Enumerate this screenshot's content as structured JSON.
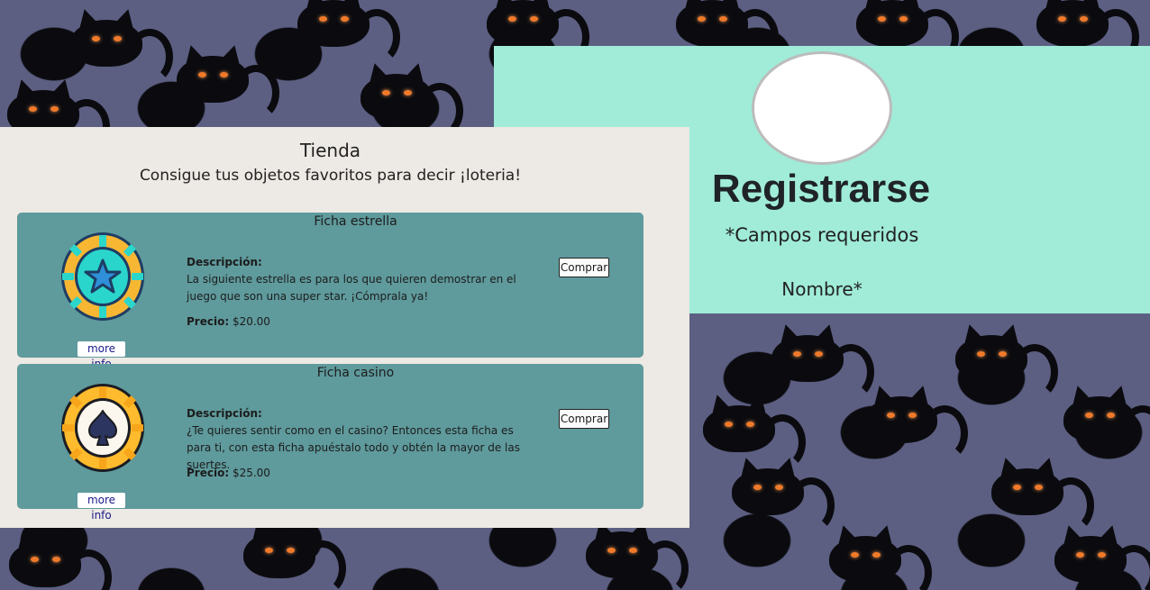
{
  "store": {
    "title": "Tienda",
    "subtitle": "Consigue tus objetos favoritos para decir ¡loteria!",
    "items": [
      {
        "name": "Ficha estrella",
        "icon": "star-chip-icon",
        "description_label": "Descripción:",
        "description": "La siguiente estrella es para los que quieren demostrar en el juego que son una super star. ¡Cómprala ya!",
        "price_label": "Precio:",
        "price": "$20.00",
        "buy_label": "Comprar",
        "more_info_label": "more info"
      },
      {
        "name": "Ficha casino",
        "icon": "spade-chip-icon",
        "description_label": "Descripción:",
        "description": "¿Te quieres sentir como en el casino? Entonces esta ficha es para ti, con esta ficha apuéstalo todo y obtén la mayor de las suertes.",
        "price_label": "Precio:",
        "price": "$25.00",
        "buy_label": "Comprar",
        "more_info_label": "more info"
      }
    ]
  },
  "register": {
    "title": "Registrarse",
    "required_note": "*Campos requeridos",
    "name_label": "Nombre*"
  },
  "colors": {
    "background": "#5c5f82",
    "register_panel": "#a0ecd8",
    "store_panel": "#ede9e4",
    "card": "#5f9a9c"
  }
}
